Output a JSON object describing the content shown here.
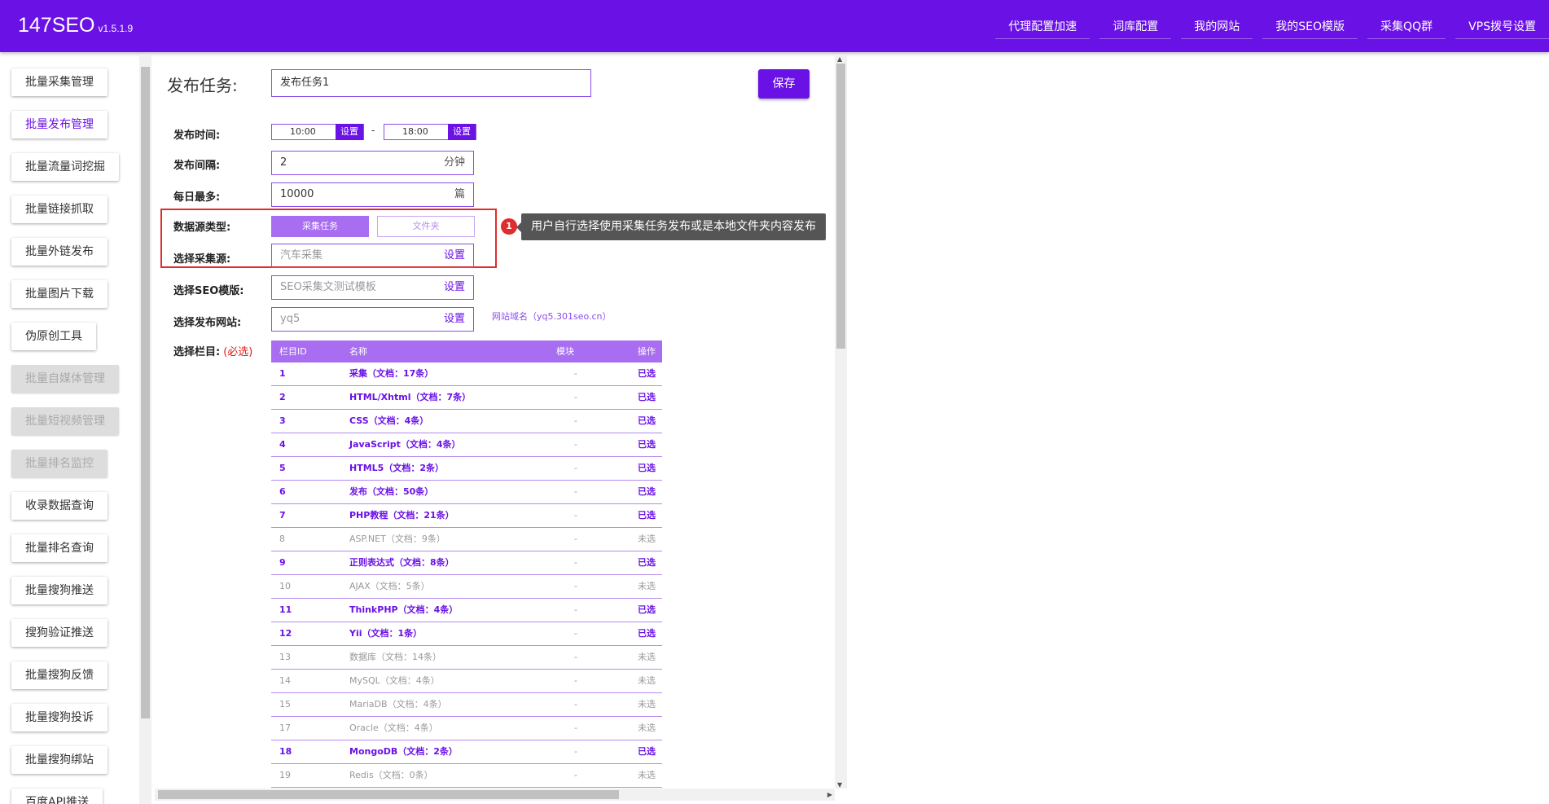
{
  "header": {
    "brand": "147SEO",
    "version": "v1.5.1.9",
    "nav": [
      "代理配置加速",
      "词库配置",
      "我的网站",
      "我的SEO模版",
      "采集QQ群",
      "VPS拨号设置"
    ]
  },
  "sidebar": {
    "items": [
      {
        "label": "批量采集管理",
        "state": "normal"
      },
      {
        "label": "批量发布管理",
        "state": "active"
      },
      {
        "label": "批量流量词挖掘",
        "state": "normal"
      },
      {
        "label": "批量链接抓取",
        "state": "normal"
      },
      {
        "label": "批量外链发布",
        "state": "normal"
      },
      {
        "label": "批量图片下载",
        "state": "normal"
      },
      {
        "label": "伪原创工具",
        "state": "normal"
      },
      {
        "label": "批量自媒体管理",
        "state": "disabled"
      },
      {
        "label": "批量短视频管理",
        "state": "disabled"
      },
      {
        "label": "批量排名监控",
        "state": "disabled"
      },
      {
        "label": "收录数据查询",
        "state": "normal"
      },
      {
        "label": "批量排名查询",
        "state": "normal"
      },
      {
        "label": "批量搜狗推送",
        "state": "normal"
      },
      {
        "label": "搜狗验证推送",
        "state": "normal"
      },
      {
        "label": "批量搜狗反馈",
        "state": "normal"
      },
      {
        "label": "批量搜狗投诉",
        "state": "normal"
      },
      {
        "label": "批量搜狗绑站",
        "state": "normal"
      },
      {
        "label": "百度API推送",
        "state": "normal"
      }
    ]
  },
  "form": {
    "task_label": "发布任务:",
    "task_name": "发布任务1",
    "save_label": "保存",
    "publish_time_label": "发布时间:",
    "time_start": "10:00",
    "time_end": "18:00",
    "time_set": "设置",
    "time_sep": "-",
    "interval_label": "发布间隔:",
    "interval_value": "2",
    "interval_unit": "分钟",
    "daily_max_label": "每日最多:",
    "daily_max_value": "10000",
    "daily_max_unit": "篇",
    "source_type_label": "数据源类型:",
    "source_task": "采集任务",
    "source_folder": "文件夹",
    "collect_source_label": "选择采集源:",
    "collect_source_value": "汽车采集",
    "seo_template_label": "选择SEO模版:",
    "seo_template_value": "SEO采集文测试模板",
    "site_label": "选择发布网站:",
    "site_value": "yq5",
    "site_domain": "网站域名（yq5.301seo.cn）",
    "set_label": "设置",
    "column_label": "选择栏目:",
    "required": "(必选)"
  },
  "annotation": {
    "number": "1",
    "text": "用户自行选择使用采集任务发布或是本地文件夹内容发布"
  },
  "table": {
    "headers": [
      "栏目ID",
      "名称",
      "模块",
      "操作"
    ],
    "rows": [
      {
        "id": "1",
        "name": "采集（文档：17条）",
        "module": "-",
        "action": "已选",
        "selected": true
      },
      {
        "id": "2",
        "name": "HTML/Xhtml（文档：7条）",
        "module": "-",
        "action": "已选",
        "selected": true
      },
      {
        "id": "3",
        "name": "CSS（文档：4条）",
        "module": "-",
        "action": "已选",
        "selected": true
      },
      {
        "id": "4",
        "name": "JavaScript（文档：4条）",
        "module": "-",
        "action": "已选",
        "selected": true
      },
      {
        "id": "5",
        "name": "HTML5（文档：2条）",
        "module": "-",
        "action": "已选",
        "selected": true
      },
      {
        "id": "6",
        "name": "发布（文档：50条）",
        "module": "-",
        "action": "已选",
        "selected": true
      },
      {
        "id": "7",
        "name": "PHP教程（文档：21条）",
        "module": "-",
        "action": "已选",
        "selected": true
      },
      {
        "id": "8",
        "name": "ASP.NET（文档：9条）",
        "module": "-",
        "action": "未选",
        "selected": false
      },
      {
        "id": "9",
        "name": "正则表达式（文档：8条）",
        "module": "-",
        "action": "已选",
        "selected": true
      },
      {
        "id": "10",
        "name": "AJAX（文档：5条）",
        "module": "-",
        "action": "未选",
        "selected": false
      },
      {
        "id": "11",
        "name": "ThinkPHP（文档：4条）",
        "module": "-",
        "action": "已选",
        "selected": true
      },
      {
        "id": "12",
        "name": "Yii（文档：1条）",
        "module": "-",
        "action": "已选",
        "selected": true
      },
      {
        "id": "13",
        "name": "数据库（文档：14条）",
        "module": "-",
        "action": "未选",
        "selected": false
      },
      {
        "id": "14",
        "name": "MySQL（文档：4条）",
        "module": "-",
        "action": "未选",
        "selected": false
      },
      {
        "id": "15",
        "name": "MariaDB（文档：4条）",
        "module": "-",
        "action": "未选",
        "selected": false
      },
      {
        "id": "17",
        "name": "Oracle（文档：4条）",
        "module": "-",
        "action": "未选",
        "selected": false
      },
      {
        "id": "18",
        "name": "MongoDB（文档：2条）",
        "module": "-",
        "action": "已选",
        "selected": true
      },
      {
        "id": "19",
        "name": "Redis（文档：0条）",
        "module": "-",
        "action": "未选",
        "selected": false
      }
    ]
  },
  "colors": {
    "primary": "#6a11e6",
    "primary_light": "#a86df0",
    "highlight": "#e02c2c"
  }
}
